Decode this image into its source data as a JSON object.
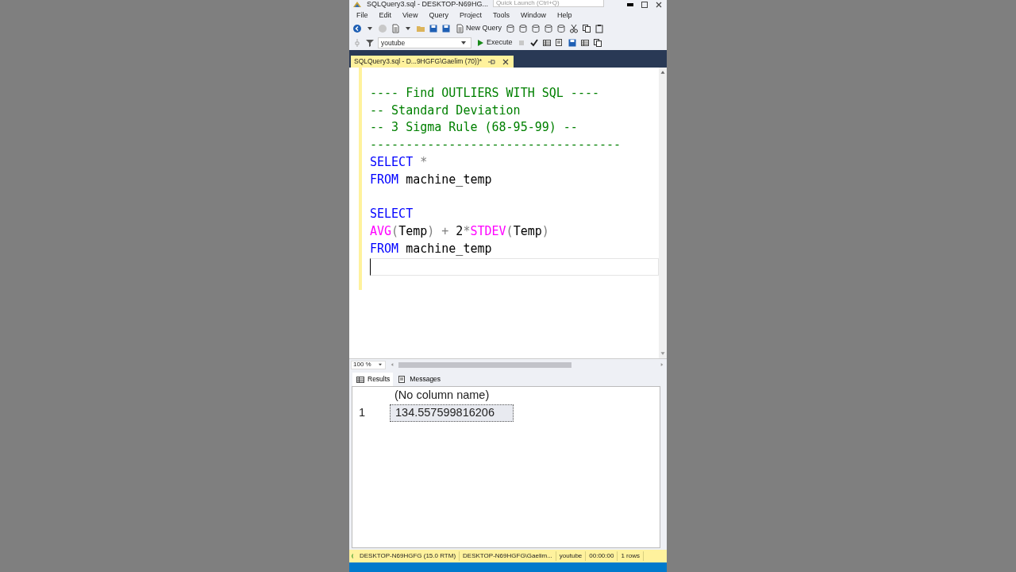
{
  "window": {
    "title": "SQLQuery3.sql - DESKTOP-N69HG...",
    "quick_launch": {
      "placeholder": "Quick Launch (Ctrl+Q)"
    }
  },
  "menu": [
    "File",
    "Edit",
    "View",
    "Query",
    "Project",
    "Tools",
    "Window",
    "Help"
  ],
  "toolbar": {
    "new_query": "New Query",
    "database": "youtube",
    "execute": "Execute"
  },
  "document_tab": {
    "label": "SQLQuery3.sql - D...9HGFG\\Gaelim (70))*",
    "selected": true
  },
  "editor": {
    "lines": [
      {
        "cursor": false
      },
      {
        "tokens": [
          {
            "text": "---- Find OUTLIERS WITH SQL ----",
            "kind": "comment"
          }
        ],
        "cursor": false
      },
      {
        "tokens": [
          {
            "text": "-- Standard Deviation",
            "kind": "comment"
          }
        ],
        "cursor": false
      },
      {
        "tokens": [
          {
            "text": "-- 3 Sigma Rule (68-95-99) --",
            "kind": "comment"
          }
        ],
        "cursor": false
      },
      {
        "tokens": [
          {
            "text": "-----------------------------------",
            "kind": "comment"
          }
        ],
        "cursor": false
      },
      {
        "tokens": [
          {
            "text": "SELECT",
            "kind": "keyword"
          },
          {
            "text": " *",
            "kind": "operator"
          }
        ],
        "cursor": false
      },
      {
        "tokens": [
          {
            "text": "FROM",
            "kind": "keyword"
          },
          {
            "text": " machine_temp",
            "kind": "plain"
          }
        ],
        "cursor": false
      },
      {
        "cursor": false
      },
      {
        "tokens": [
          {
            "text": "SELECT",
            "kind": "keyword"
          }
        ],
        "cursor": false
      },
      {
        "tokens": [
          {
            "text": "AVG",
            "kind": "function"
          },
          {
            "text": "(",
            "kind": "operator"
          },
          {
            "text": "Temp",
            "kind": "plain"
          },
          {
            "text": ")",
            "kind": "operator"
          },
          {
            "text": " +",
            "kind": "operator"
          },
          {
            "text": " 2",
            "kind": "plain"
          },
          {
            "text": "*",
            "kind": "operator"
          },
          {
            "text": "STDEV",
            "kind": "function"
          },
          {
            "text": "(",
            "kind": "operator"
          },
          {
            "text": "Temp",
            "kind": "plain"
          },
          {
            "text": ")",
            "kind": "operator"
          }
        ],
        "cursor": false
      },
      {
        "tokens": [
          {
            "text": "FROM",
            "kind": "keyword"
          },
          {
            "text": " machine_temp",
            "kind": "plain"
          }
        ],
        "cursor": false
      },
      {
        "cursor": true
      }
    ]
  },
  "zoom": "100 %",
  "result_tabs": [
    {
      "label": "Results",
      "selected": true
    },
    {
      "label": "Messages",
      "selected": false
    }
  ],
  "results": {
    "columns": [
      "(No column name)"
    ],
    "rows": [
      {
        "number": "1",
        "cells": [
          {
            "text": "134.557599816206",
            "selected": true
          }
        ]
      }
    ]
  },
  "status_bar": [
    "DESKTOP-N69HGFG (15.0 RTM)",
    "DESKTOP-N69HGFG\\Gaelim...",
    "youtube",
    "00:00:00",
    "1 rows"
  ]
}
